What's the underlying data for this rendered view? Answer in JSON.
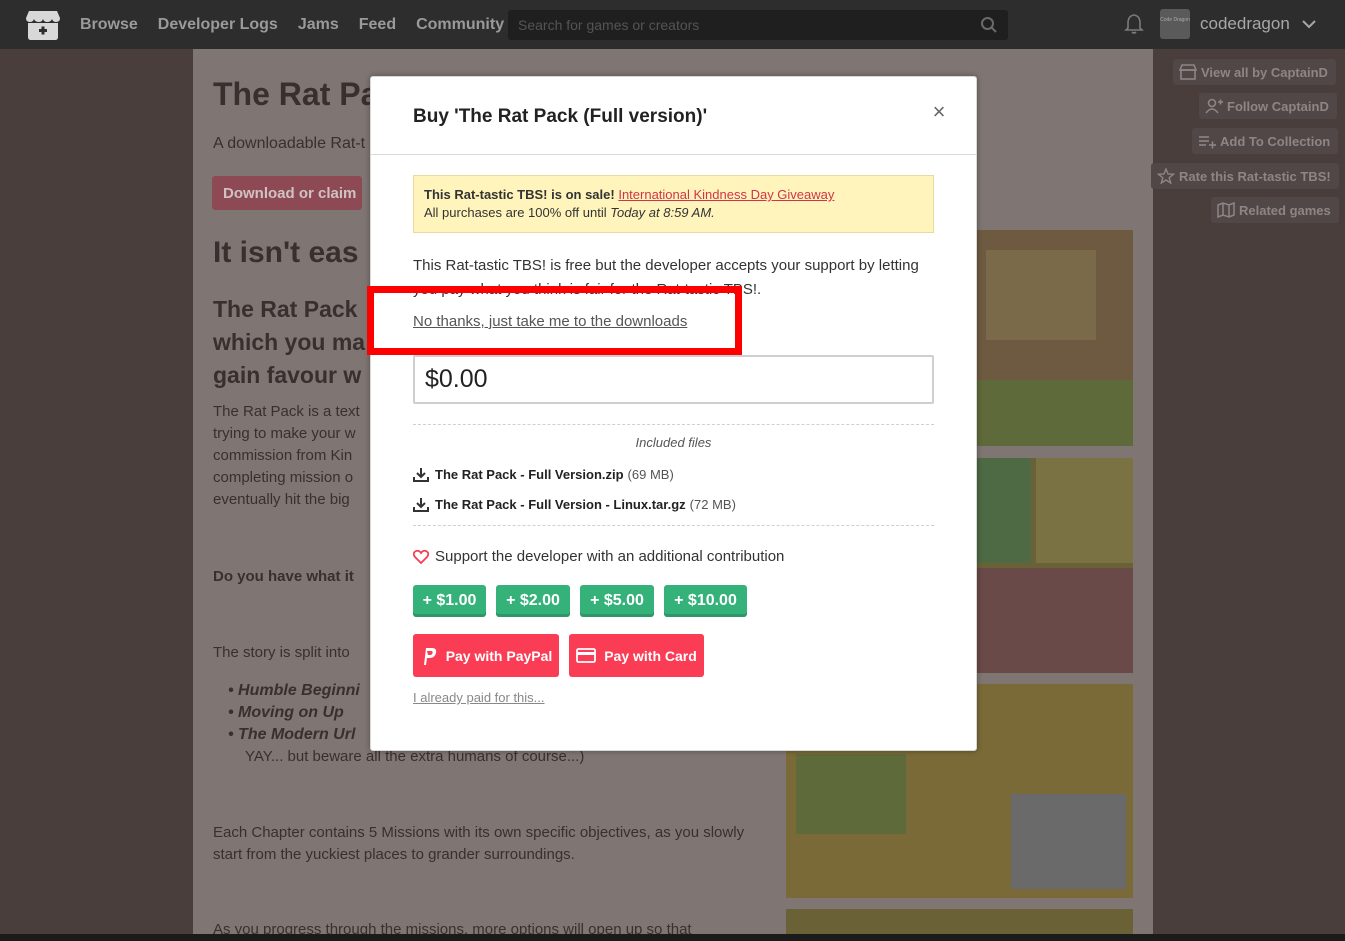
{
  "nav": {
    "links": [
      "Browse",
      "Developer Logs",
      "Jams",
      "Feed",
      "Community"
    ],
    "search_placeholder": "Search for games or creators",
    "username": "codedragon",
    "avatar_text": "Code Dragon"
  },
  "background": {
    "title": "The Rat Pa",
    "subtitle": "A downloadable Rat-t",
    "download_button": "Download or claim",
    "heading2": "It isn't eas",
    "heading3": "The Rat Pack which you ma gain favour w",
    "para1": "The Rat Pack is a text trying to make your w commission from Kin completing mission o eventually hit the big",
    "question": "Do you have what it",
    "story": "The story is split into",
    "list": [
      "Humble Beginni",
      "Moving on Up",
      "The Modern Url"
    ],
    "list_tail": "YAY... but beware all the extra humans of course...)",
    "chapters": "Each Chapter contains 5 Missions with its own specific objectives, as you slowly start from the yuckiest places to grander surroundings.",
    "progress": "As you progress through the missions, more options will open up so that",
    "side_buttons": [
      "View all by CaptainD",
      "Follow CaptainD",
      "Add To Collection",
      "Rate this Rat-tastic TBS!",
      "Related games"
    ]
  },
  "modal": {
    "title": "Buy 'The Rat Pack (Full version)'",
    "close_label": "×",
    "sale": {
      "prefix": "This Rat-tastic TBS! is on sale!",
      "link": "International Kindness Day Giveaway",
      "line2_prefix": "All purchases are 100% off until",
      "line2_time": "Today at 8:59 AM."
    },
    "free_text": "This Rat-tastic TBS! is free but the developer accepts your support by letting you pay what you think is fair for the Rat-tastic TBS!.",
    "no_thanks": "No thanks, just take me to the downloads",
    "price_value": "$0.00",
    "included_label": "Included files",
    "files": [
      {
        "name": "The Rat Pack - Full Version.zip",
        "size": "(69 MB)"
      },
      {
        "name": "The Rat Pack - Full Version - Linux.tar.gz",
        "size": "(72 MB)"
      }
    ],
    "support_text": "Support the developer with an additional contribution",
    "tips": [
      "+ $1.00",
      "+ $2.00",
      "+ $5.00",
      "+ $10.00"
    ],
    "pay_paypal": "Pay with PayPal",
    "pay_card": "Pay with Card",
    "already_paid": "I already paid for this..."
  },
  "colors": {
    "accent": "#fa3c54",
    "tip_green": "#35b27a",
    "sale_bg": "#fff4bb",
    "highlight": "#ff0000"
  }
}
